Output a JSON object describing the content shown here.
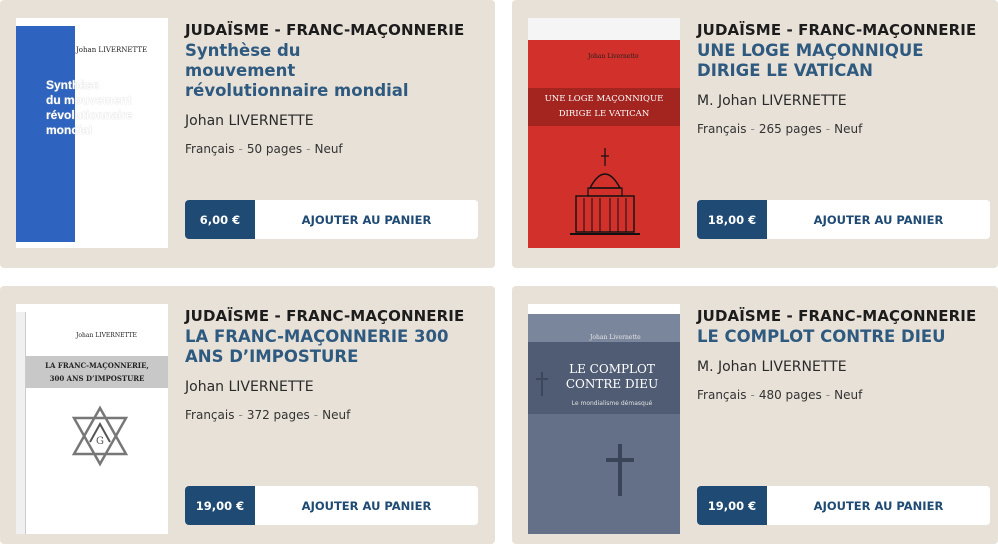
{
  "cards": [
    {
      "category": "JUDAÏSME - FRANC-MAÇONNERIE",
      "title": "Synthèse du mouvement révolutionnaire mondial",
      "author": "Johan LIVERNETTE",
      "language": "Français",
      "pages": "50 pages",
      "condition": "Neuf",
      "price": "6,00 €",
      "add_label": "AJOUTER AU PANIER",
      "cover": {
        "author": "Johan LIVERNETTE",
        "title_line1": "Synthèse",
        "title_line2": "du mouvement",
        "title_line3": "révolutionnaire",
        "title_line4": "mondial",
        "accent": "#2e64bf"
      }
    },
    {
      "category": "JUDAÏSME - FRANC-MAÇONNERIE",
      "title": "UNE LOGE MAÇONNIQUE DIRIGE LE VATICAN",
      "author": "M. Johan LIVERNETTE",
      "language": "Français",
      "pages": "265 pages",
      "condition": "Neuf",
      "price": "18,00 €",
      "add_label": "AJOUTER AU PANIER",
      "cover": {
        "author": "Johan Livernette",
        "title_line1": "UNE LOGE MAÇONNIQUE",
        "title_line2": "DIRIGE LE VATICAN",
        "accent": "#d2302a"
      }
    },
    {
      "category": "JUDAÏSME - FRANC-MAÇONNERIE",
      "title": "LA FRANC-MAÇONNERIE 300 ANS D’IMPOSTURE",
      "author": "Johan LIVERNETTE",
      "language": "Français",
      "pages": "372 pages",
      "condition": "Neuf",
      "price": "19,00 €",
      "add_label": "AJOUTER AU PANIER",
      "cover": {
        "author": "Johan LIVERNETTE",
        "title_line1": "LA FRANC-MAÇONNERIE,",
        "title_line2": "300 ANS D’IMPOSTURE",
        "accent": "#c8c8c8"
      }
    },
    {
      "category": "JUDAÏSME - FRANC-MAÇONNERIE",
      "title": "LE COMPLOT CONTRE DIEU",
      "author": "M. Johan LIVERNETTE",
      "language": "Français",
      "pages": "480 pages",
      "condition": "Neuf",
      "price": "19,00 €",
      "add_label": "AJOUTER AU PANIER",
      "cover": {
        "author": "Johan Livernette",
        "title_line1": "LE COMPLOT",
        "title_line2": "CONTRE DIEU",
        "subtitle": "Le mondialisme démasqué",
        "accent": "#637087"
      }
    }
  ],
  "colors": {
    "card_bg": "#e8e1d8",
    "title_blue": "#2f5a80",
    "price_bg": "#1f4a73"
  }
}
